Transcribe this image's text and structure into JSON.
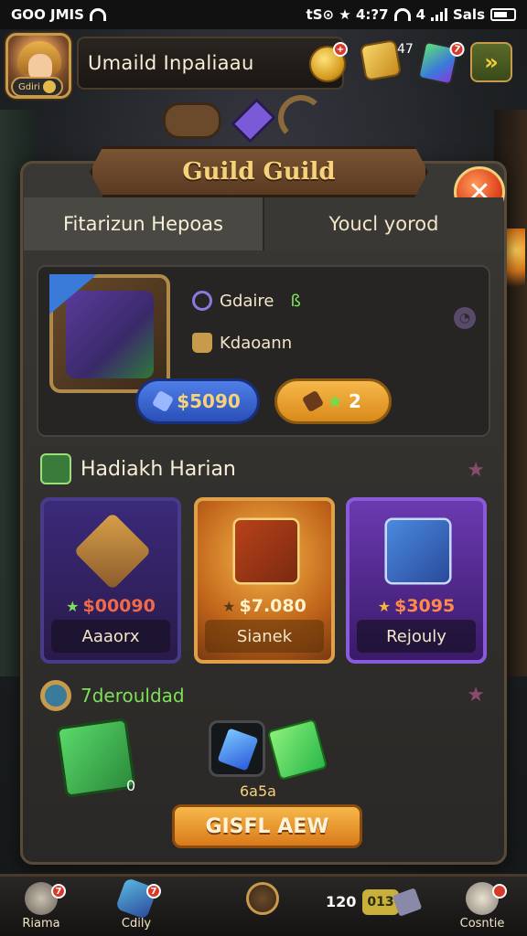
{
  "status_bar": {
    "left_text": "GOO JMIS",
    "center_text": "tS⊙ ★ 4:?7",
    "signal_text": "4",
    "right_text": "Sals"
  },
  "hud": {
    "player_name": "Umaild Inpaliaau",
    "level_badge": "Gdiri",
    "plate_notification": "+",
    "currency_count": "47",
    "gem_notification": "7"
  },
  "panel": {
    "title": "Guild  Guild",
    "close_label": "✕",
    "tabs": [
      {
        "label": "Fitarizun Hepoas",
        "active": true
      },
      {
        "label": "Youcl yorod",
        "active": false
      }
    ]
  },
  "guild": {
    "name": "Gdaire",
    "name_suffix": "ß",
    "role": "Kdaoann",
    "info_icon": "clock",
    "primary_button": "$5090",
    "secondary_button": "2"
  },
  "shop": {
    "title": "Hadiakh Harian",
    "items": [
      {
        "price": "$00090",
        "label": "Aaaorx",
        "accent": "#3a2a7a"
      },
      {
        "price": "$7.080",
        "label": "Sianek",
        "accent": "#c0641a"
      },
      {
        "price": "$3095",
        "label": "Rejouly",
        "accent": "#6a3ab0"
      }
    ]
  },
  "rewards": {
    "title": "7derouldad",
    "box_count": "0",
    "gem_label": "6a5a",
    "claim_button": "GISFL AEW"
  },
  "bottom_nav": {
    "items": [
      {
        "label": "Riama",
        "badge": "7"
      },
      {
        "label": "Cdily",
        "badge": "7"
      },
      {
        "label": ""
      },
      {
        "label": "Cosntie"
      }
    ],
    "count_text": "120",
    "count_chip": "013"
  },
  "colors": {
    "accent_gold": "#f6d27a",
    "accent_green": "#7ee05a",
    "danger_red": "#e0461e",
    "panel_bg": "#2a2826"
  }
}
